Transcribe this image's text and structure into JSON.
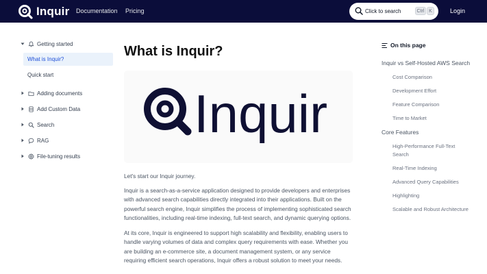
{
  "header": {
    "brand": "Inquir",
    "nav": [
      "Documentation",
      "Pricing"
    ],
    "search_label": "Click to search",
    "shortcut_keys": [
      "Ctrl",
      "K"
    ],
    "login": "Login"
  },
  "sidebar": {
    "getting_started": "Getting started",
    "sub_items": [
      "What is Inquir?",
      "Quick start"
    ],
    "items": [
      "Adding documents",
      "Add Custom Data",
      "Search",
      "RAG",
      "File-tuning results"
    ]
  },
  "main": {
    "title": "What is Inquir?",
    "hero_logo_text": "Inquir",
    "paragraphs": [
      "Let's start our Inquir journey.",
      "Inquir is a search-as-a-service application designed to provide developers and enterprises with advanced search capabilities directly integrated into their applications. Built on the powerful search engine, Inquir simplifies the process of implementing sophisticated search functionalities, including real-time indexing, full-text search, and dynamic querying options.",
      "At its core, Inquir is engineered to support high scalability and flexibility, enabling users to handle varying volumes of data and complex query requirements with ease. Whether you are building an e-commerce site, a document management system, or any service requiring efficient search operations, Inquir offers a robust solution to meet your needs."
    ]
  },
  "toc": {
    "heading": "On this page",
    "sections": [
      {
        "title": "Inquir vs Self-Hosted AWS Search",
        "items": [
          "Cost Comparison",
          "Development Effort",
          "Feature Comparison",
          "Time to Market"
        ]
      },
      {
        "title": "Core Features",
        "items": [
          "High-Performance Full-Text Search",
          "Real-Time Indexing",
          "Advanced Query Capabilities",
          "Highlighting",
          "Scalable and Robust Architecture"
        ]
      }
    ]
  },
  "colors": {
    "header_bg": "#0b0d3a",
    "active_bg": "#eaf2fb",
    "active_text": "#1d4ed8",
    "logo_dark": "#0f1033"
  }
}
